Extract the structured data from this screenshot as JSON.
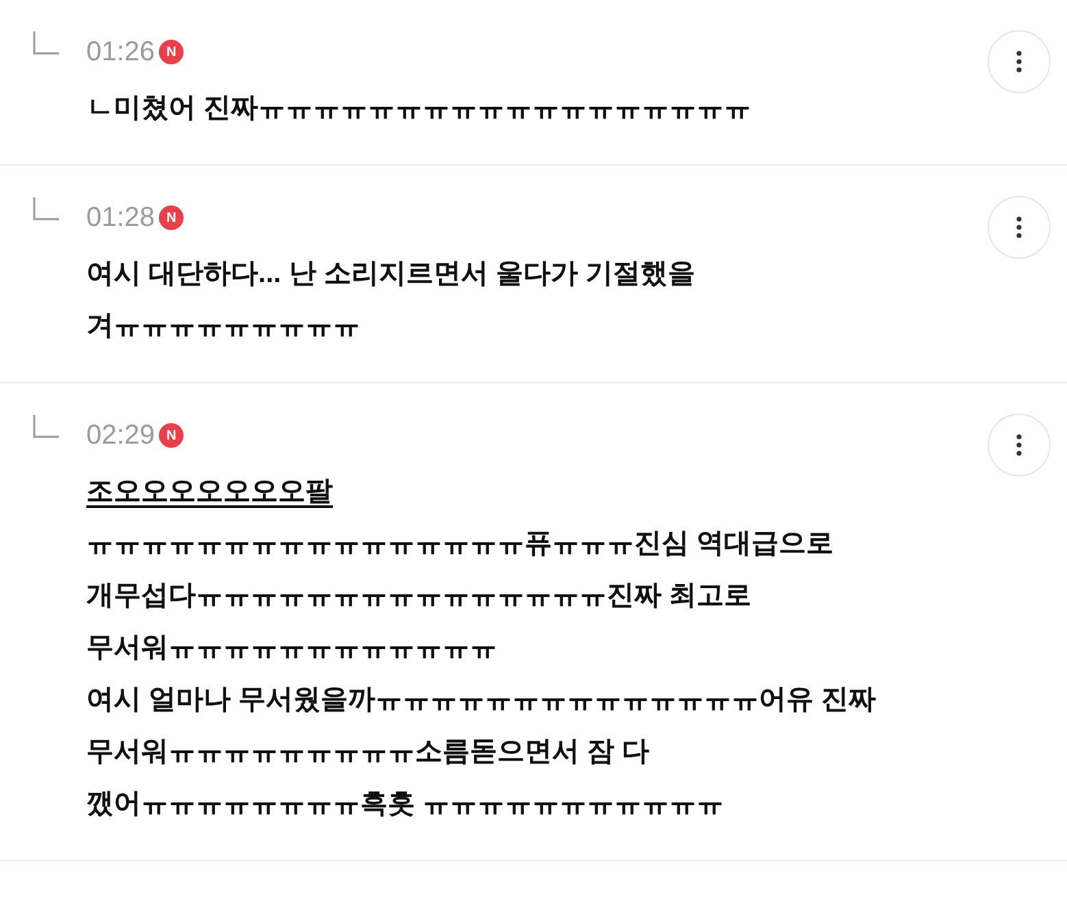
{
  "comments": [
    {
      "time": "01:26",
      "is_new": true,
      "badge": "N",
      "lines": [
        {
          "text": "ㄴ미쳤어 진짜ㅠㅠㅠㅠㅠㅠㅠㅠㅠㅠㅠㅠㅠㅠㅠㅠㅠㅠ",
          "underlined": false
        }
      ]
    },
    {
      "time": "01:28",
      "is_new": true,
      "badge": "N",
      "lines": [
        {
          "text": "여시 대단하다... 난 소리지르면서 울다가 기절했을",
          "underlined": false
        },
        {
          "text": "겨ㅠㅠㅠㅠㅠㅠㅠㅠㅠ",
          "underlined": false
        }
      ]
    },
    {
      "time": "02:29",
      "is_new": true,
      "badge": "N",
      "lines": [
        {
          "text": "조오오오오오오오팔",
          "underlined": true
        },
        {
          "text": "ㅠㅠㅠㅠㅠㅠㅠㅠㅠㅠㅠㅠㅠㅠㅠㅠ퓨ㅠㅠㅠ진심 역대급으로",
          "underlined": false
        },
        {
          "text": "개무섭다ㅠㅠㅠㅠㅠㅠㅠㅠㅠㅠㅠㅠㅠㅠㅠ진짜 최고로",
          "underlined": false
        },
        {
          "text": "무서워ㅠㅠㅠㅠㅠㅠㅠㅠㅠㅠㅠㅠ",
          "underlined": false
        },
        {
          "text": "여시 얼마나 무서웠을까ㅠㅠㅠㅠㅠㅠㅠㅠㅠㅠㅠㅠㅠㅠ어유 진짜",
          "underlined": false
        },
        {
          "text": "무서워ㅠㅠㅠㅠㅠㅠㅠㅠㅠ소름돋으면서 잠 다",
          "underlined": false
        },
        {
          "text": "깼어ㅠㅠㅠㅠㅠㅠㅠㅠ흑흣 ㅠㅠㅠㅠㅠㅠㅠㅠㅠㅠㅠ",
          "underlined": false
        }
      ]
    }
  ]
}
